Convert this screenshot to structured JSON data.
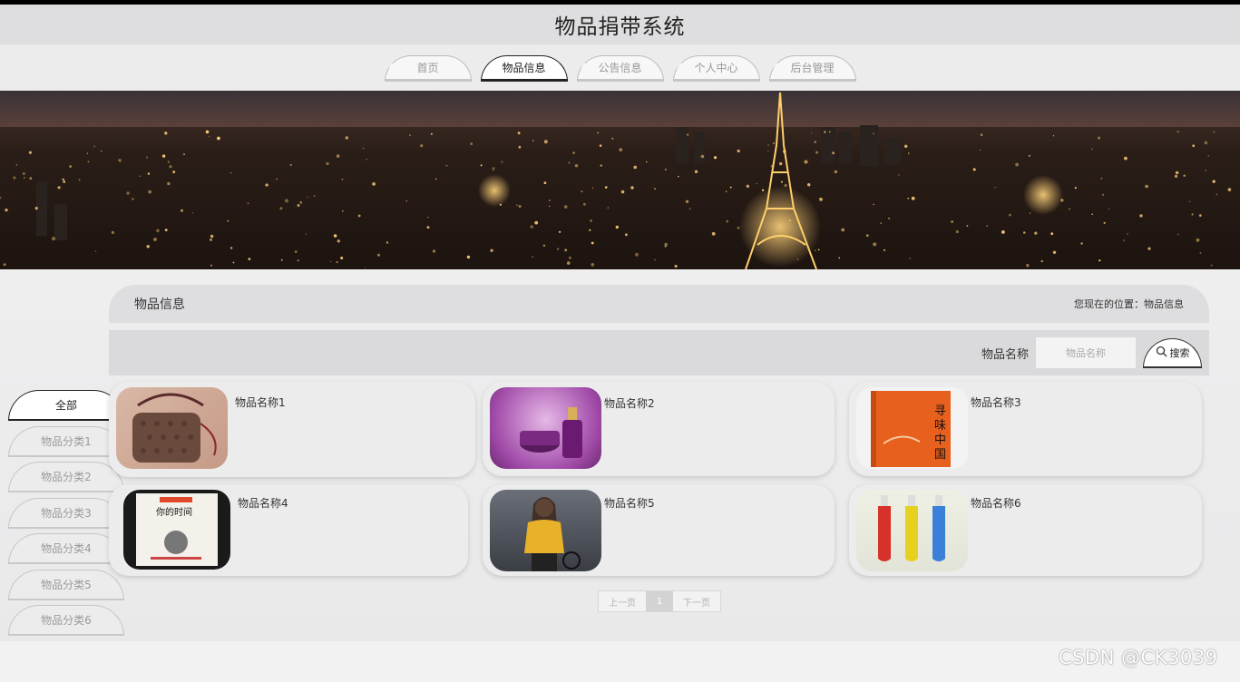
{
  "site": {
    "title": "物品捐带系统"
  },
  "nav": {
    "items": [
      {
        "label": "首页"
      },
      {
        "label": "物品信息"
      },
      {
        "label": "公告信息"
      },
      {
        "label": "个人中心"
      },
      {
        "label": "后台管理"
      }
    ],
    "active_index": 1
  },
  "section": {
    "title": "物品信息",
    "breadcrumb": "您现在的位置：物品信息"
  },
  "search": {
    "label": "物品名称",
    "placeholder": "物品名称",
    "button_label": "搜索",
    "button_icon": "search-icon"
  },
  "categories": {
    "items": [
      {
        "label": "全部"
      },
      {
        "label": "物品分类1"
      },
      {
        "label": "物品分类2"
      },
      {
        "label": "物品分类3"
      },
      {
        "label": "物品分类4"
      },
      {
        "label": "物品分类5"
      },
      {
        "label": "物品分类6"
      }
    ],
    "active_index": 0
  },
  "items": [
    {
      "name": "物品名称1",
      "image": "handbag"
    },
    {
      "name": "物品名称2",
      "image": "cosmetics"
    },
    {
      "name": "物品名称3",
      "image": "orange-book"
    },
    {
      "name": "物品名称4",
      "image": "book-cover"
    },
    {
      "name": "物品名称5",
      "image": "woman-yellow-sweater"
    },
    {
      "name": "物品名称6",
      "image": "drink-bottles"
    }
  ],
  "pagination": {
    "prev": "上一页",
    "current": "1",
    "next": "下一页"
  },
  "watermark": "CSDN @CK3039",
  "colors": {
    "active_border": "#222222",
    "inactive_text": "#999999",
    "header_bg": "#dedee0"
  }
}
